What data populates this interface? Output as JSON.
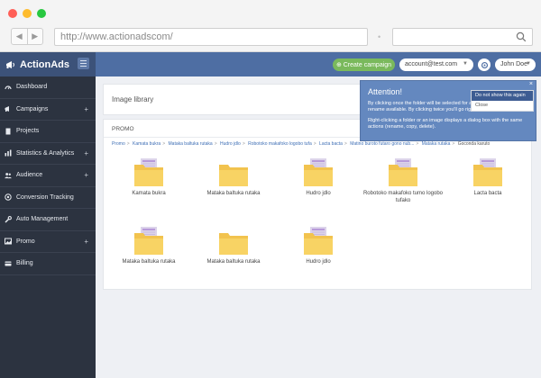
{
  "browser": {
    "url": "http://www.actionadscom/",
    "dots": [
      "#ff5f57",
      "#febc2e",
      "#28c840"
    ],
    "back_icon": "arrow-left-icon",
    "forward_icon": "arrow-right-icon",
    "search_icon": "search-icon"
  },
  "header": {
    "logo": "ActionAds",
    "logo_icon": "megaphone-icon",
    "create_campaign": "⊕ Create campaign",
    "account": "account@test.com",
    "user": "John Doe",
    "settings_icon": "gear-icon",
    "accent": "#4e6ea3"
  },
  "sidebar": {
    "items": [
      {
        "label": "Dashboard",
        "icon": "dashboard-icon",
        "expandable": false
      },
      {
        "label": "Campaigns",
        "icon": "megaphone-icon",
        "expandable": true
      },
      {
        "label": "Projects",
        "icon": "document-icon",
        "expandable": false
      },
      {
        "label": "Statistics & Analytics",
        "icon": "chart-icon",
        "expandable": true
      },
      {
        "label": "Audience",
        "icon": "users-icon",
        "expandable": true
      },
      {
        "label": "Conversion Tracking",
        "icon": "target-icon",
        "expandable": false
      },
      {
        "label": "Auto Management",
        "icon": "wrench-icon",
        "expandable": false
      },
      {
        "label": "Promo",
        "icon": "image-icon",
        "expandable": true
      },
      {
        "label": "Billing",
        "icon": "card-icon",
        "expandable": false
      }
    ],
    "plus": "+"
  },
  "main": {
    "title": "Image library",
    "panel_title": "PROMO",
    "breadcrumb": [
      "Promo",
      "Kamata bukra",
      "Mataka baltuka rutaka",
      "Hudro jdlo",
      "Robotoko makafoko logobo tufa",
      "Lacta bacta",
      "Matino buroto futaro gono nub...",
      "Mataka rutaka",
      "Goconda karuto"
    ],
    "breadcrumb_sep": ">",
    "items": [
      {
        "label": "Kamata bukra",
        "has_images": true
      },
      {
        "label": "Mataka baltuka rutaka",
        "has_images": false
      },
      {
        "label": "Hudro jdlo",
        "has_images": true
      },
      {
        "label": "Robotoko makafoko tumo logobo tufako",
        "has_images": true
      },
      {
        "label": "Lacta bacta",
        "has_images": true
      },
      {
        "label": "Mataka baltuka rutaka",
        "has_images": true
      },
      {
        "label": "Mataka baltuka rutaka",
        "has_images": false
      },
      {
        "label": "Hudro jdlo",
        "has_images": true
      }
    ]
  },
  "popup": {
    "title": "Attention!",
    "text1": "By clicking once  the folder will be selected  for actions as copy, delete, rename available. By clicking twice you'll go right into the folder.",
    "text2": "Right-clicking a folder or an image displays a dialog box with the same actions (rename, copy, delete).",
    "close": "×",
    "menu": [
      "Do not show this again",
      "Close"
    ]
  }
}
